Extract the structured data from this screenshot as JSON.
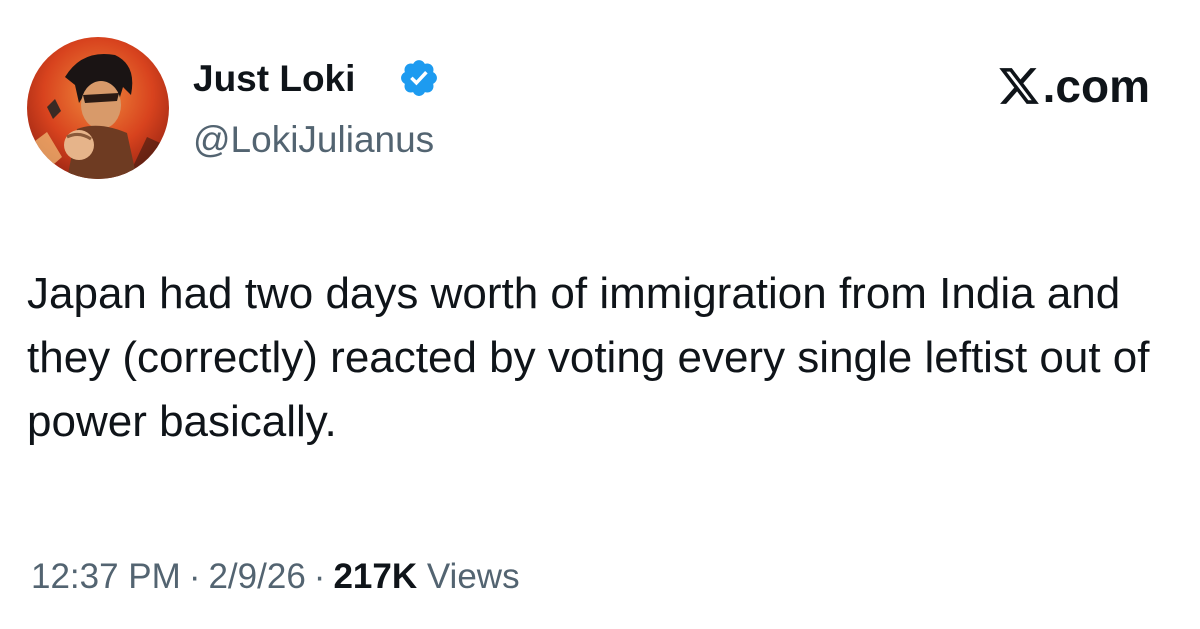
{
  "author": {
    "display_name": "Just Loki",
    "handle": "@LokiJulianus",
    "verified": true,
    "badge_color": "#1d9bf0"
  },
  "brand": {
    "domain": ".com",
    "icon": "x-logo-icon"
  },
  "tweet": {
    "text": "Japan had two days worth of immigration from India and they (correctly) reacted by voting every single leftist out of power basically."
  },
  "meta": {
    "time": "12:37 PM",
    "date": "2/9/26",
    "separator": "·",
    "views_count": "217K",
    "views_label": "Views"
  },
  "colors": {
    "text_primary": "#0f1419",
    "text_secondary": "#536471"
  }
}
